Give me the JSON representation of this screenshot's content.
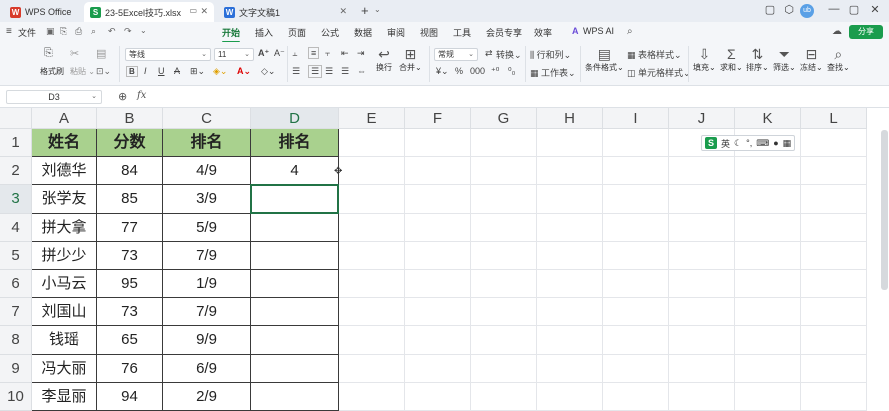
{
  "titlebar": {
    "tabs": [
      {
        "label": "WPS Office",
        "icon": "wps-logo-icon",
        "color": "#d83b2b"
      },
      {
        "label": "23-5Excel技巧.xlsx",
        "icon": "spreadsheet-icon",
        "color": "#1a9c4d"
      },
      {
        "label": "文字文稿1",
        "icon": "word-doc-icon",
        "color": "#2b6fd8"
      }
    ],
    "new_tab": "+",
    "avatar": "ub"
  },
  "menubar": {
    "file": "文件",
    "tabs": [
      "开始",
      "插入",
      "页面",
      "公式",
      "数据",
      "审阅",
      "视图",
      "工具",
      "会员专享",
      "效率"
    ],
    "active_tab": "开始",
    "wps_ai": "WPS AI",
    "share": "分享"
  },
  "ribbon": {
    "format_painter": "格式刷",
    "paste": "粘贴",
    "font_name": "等线",
    "font_size": "11",
    "wrap": "换行",
    "merge": "合并",
    "number_format": "常规",
    "convert": "转换",
    "row_col": "行和列",
    "worksheet": "工作表",
    "cond_format": "条件格式",
    "table_style": "表格样式",
    "cell_style": "单元格样式",
    "fill": "填充",
    "sum": "求和",
    "sort": "排序",
    "filter": "筛选",
    "freeze": "冻结",
    "find": "查找"
  },
  "formulabar": {
    "name_box": "D3",
    "fx": "fx",
    "value": ""
  },
  "sheet": {
    "columns": [
      "A",
      "B",
      "C",
      "D",
      "E",
      "F",
      "G",
      "H",
      "I",
      "J",
      "K",
      "L"
    ],
    "rows": [
      "1",
      "2",
      "3",
      "4",
      "5",
      "6",
      "7",
      "8",
      "9",
      "10"
    ],
    "selected_col": "D",
    "selected_row": "3",
    "header": [
      "姓名",
      "分数",
      "排名",
      "排名"
    ],
    "data": [
      [
        "刘德华",
        "84",
        "4/9",
        "4"
      ],
      [
        "张学友",
        "85",
        "3/9",
        ""
      ],
      [
        "拼大拿",
        "77",
        "5/9",
        ""
      ],
      [
        "拼少少",
        "73",
        "7/9",
        ""
      ],
      [
        "小马云",
        "95",
        "1/9",
        ""
      ],
      [
        "刘国山",
        "73",
        "7/9",
        ""
      ],
      [
        "钱瑶",
        "65",
        "9/9",
        ""
      ],
      [
        "冯大丽",
        "76",
        "6/9",
        ""
      ],
      [
        "李显丽",
        "94",
        "2/9",
        ""
      ]
    ],
    "header_color": "#a9d18e",
    "selection_color": "#217346"
  },
  "ime_toolbar": {
    "logo": "S",
    "lang": "英",
    "icons": [
      "moon-icon",
      "punctuation-icon",
      "keyboard-icon",
      "user-icon",
      "grid-icon"
    ]
  }
}
